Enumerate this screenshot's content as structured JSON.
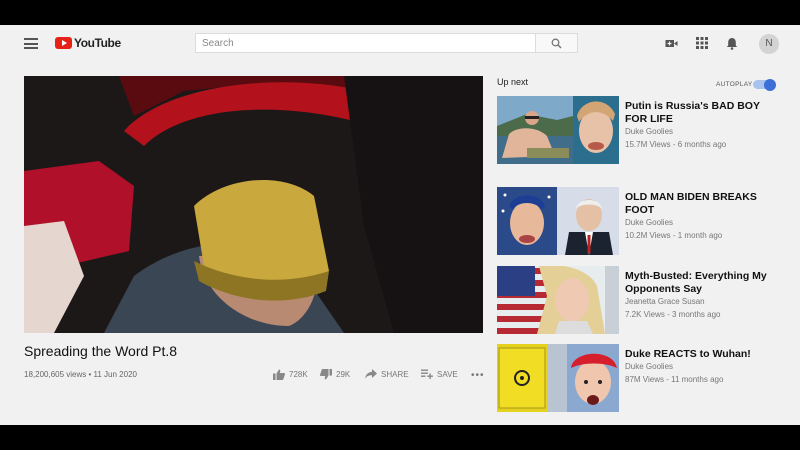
{
  "header": {
    "logo_text": "YouTube",
    "search_placeholder": "Search",
    "avatar_letter": "N"
  },
  "video": {
    "title": "Spreading the Word Pt.8",
    "views": "18,200,605 views",
    "date": "11 Jun 2020",
    "likes": "728K",
    "dislikes": "29K",
    "share_label": "SHARE",
    "save_label": "SAVE",
    "more_label": "•••"
  },
  "up_next": {
    "label": "Up next",
    "autoplay_label": "AUTOPLAY",
    "autoplay_on": true,
    "items": [
      {
        "title": "Putin is Russia's BAD BOY FOR LIFE",
        "channel": "Duke Goolies",
        "stats": "15.7M Views - 6 months ago"
      },
      {
        "title": "OLD MAN BIDEN BREAKS FOOT",
        "channel": "Duke Goolies",
        "stats": "10.2M Views - 1 month ago"
      },
      {
        "title": "Myth-Busted: Everything My Opponents Say",
        "channel": "Jeanetta Grace Susan",
        "stats": "7.2K Views - 3 months ago"
      },
      {
        "title": "Duke REACTS to Wuhan!",
        "channel": "Duke Goolies",
        "stats": "87M Views - 11 months ago"
      }
    ]
  },
  "colors": {
    "brand_red": "#e62117",
    "autoplay_blue": "#3d6fd9",
    "page_bg": "#f1f1f1"
  }
}
